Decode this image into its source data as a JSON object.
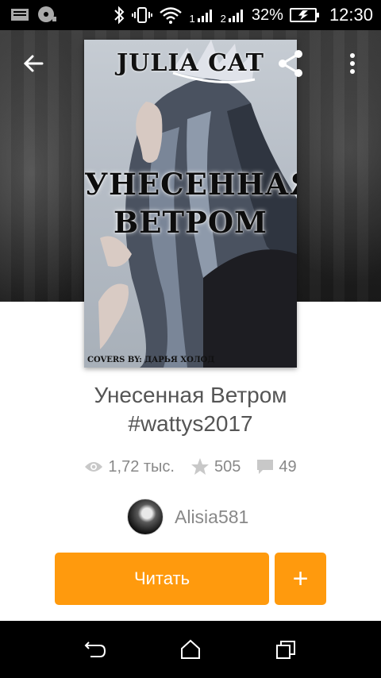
{
  "status_bar": {
    "signal1": "1",
    "signal2": "2",
    "battery_text": "32%",
    "time": "12:30"
  },
  "cover": {
    "author_text": "JULIA CAT",
    "title_line1": "УНЕСЕННАЯ",
    "title_line2": "ВЕТРОМ",
    "credit": "COVERS BY: ДАРЬЯ ХОЛОД"
  },
  "book": {
    "title": "Унесенная Ветром #wattys2017",
    "views": "1,72 тыс.",
    "votes": "505",
    "comments": "49"
  },
  "author": {
    "name": "Alisia581"
  },
  "actions": {
    "read_label": "Читать",
    "add_label": "+"
  },
  "colors": {
    "accent": "#ff9a0d",
    "muted_text": "#888888"
  },
  "icons": [
    "back-arrow-icon",
    "share-icon",
    "more-vert-icon",
    "eye-icon",
    "star-icon",
    "comment-icon",
    "nav-back-icon",
    "nav-home-icon",
    "nav-recents-icon"
  ]
}
